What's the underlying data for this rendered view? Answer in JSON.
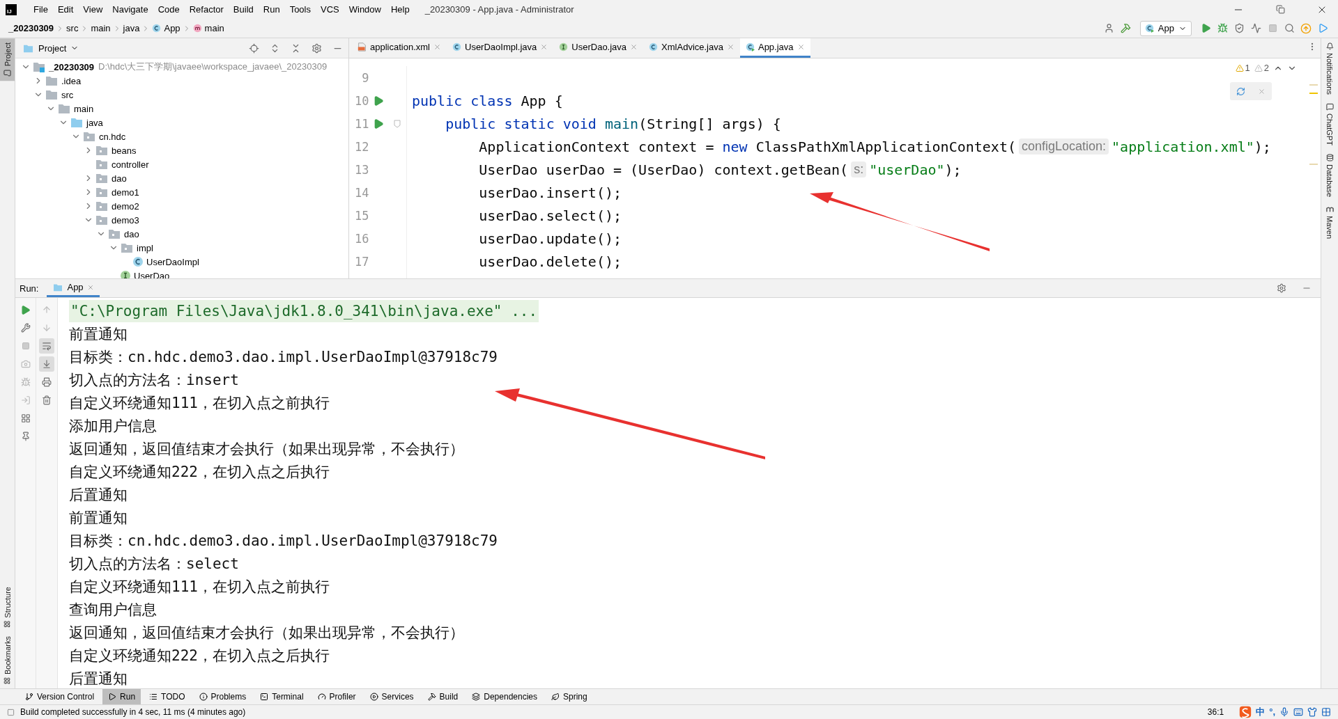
{
  "window": {
    "logo": "IJ",
    "title": "_20230309 - App.java - Administrator"
  },
  "menu": [
    "File",
    "Edit",
    "View",
    "Navigate",
    "Code",
    "Refactor",
    "Build",
    "Run",
    "Tools",
    "VCS",
    "Window",
    "Help"
  ],
  "breadcrumbs": [
    {
      "label": "_20230309",
      "kind": "module"
    },
    {
      "label": "src",
      "kind": "plain"
    },
    {
      "label": "main",
      "kind": "plain"
    },
    {
      "label": "java",
      "kind": "plain"
    },
    {
      "label": "App",
      "kind": "class"
    },
    {
      "label": "main",
      "kind": "method"
    }
  ],
  "run_config": "App",
  "left_tabs": [
    {
      "label": "Project",
      "selected": true
    }
  ],
  "left_bottom_tabs": [
    {
      "label": "Structure",
      "selected": false
    },
    {
      "label": "Bookmarks",
      "selected": false
    }
  ],
  "right_tabs": [
    {
      "label": "Notifications",
      "kind": "bell"
    },
    {
      "label": "ChatGPT",
      "kind": "chat"
    },
    {
      "label": "Database",
      "kind": "database"
    },
    {
      "label": "Maven",
      "kind": "maven"
    }
  ],
  "project": {
    "title": "Project",
    "tree": [
      {
        "label": "_20230309",
        "kind": "module",
        "path": "D:\\hdc\\大三下学期\\javaee\\workspace_javaee\\_20230309",
        "expanded": true,
        "children": [
          {
            "label": ".idea",
            "kind": "folder",
            "expanded": false
          },
          {
            "label": "src",
            "kind": "folder",
            "expanded": true,
            "children": [
              {
                "label": "main",
                "kind": "folder",
                "expanded": true,
                "children": [
                  {
                    "label": "java",
                    "kind": "source",
                    "expanded": true,
                    "children": [
                      {
                        "label": "cn.hdc",
                        "kind": "package",
                        "expanded": true,
                        "children": [
                          {
                            "label": "beans",
                            "kind": "package",
                            "expanded": false
                          },
                          {
                            "label": "controller",
                            "kind": "package"
                          },
                          {
                            "label": "dao",
                            "kind": "package",
                            "expanded": false
                          },
                          {
                            "label": "demo1",
                            "kind": "package",
                            "expanded": false
                          },
                          {
                            "label": "demo2",
                            "kind": "package",
                            "expanded": false
                          },
                          {
                            "label": "demo3",
                            "kind": "package",
                            "expanded": true,
                            "children": [
                              {
                                "label": "dao",
                                "kind": "package",
                                "expanded": true,
                                "children": [
                                  {
                                    "label": "impl",
                                    "kind": "package",
                                    "expanded": true,
                                    "children": [
                                      {
                                        "label": "UserDaoImpl",
                                        "kind": "class"
                                      }
                                    ]
                                  },
                                  {
                                    "label": "UserDao",
                                    "kind": "interface"
                                  }
                                ]
                              }
                            ]
                          }
                        ]
                      }
                    ]
                  }
                ]
              }
            ]
          }
        ]
      }
    ]
  },
  "editor": {
    "tabs": [
      {
        "label": "application.xml",
        "kind": "xml",
        "selected": false
      },
      {
        "label": "UserDaoImpl.java",
        "kind": "class",
        "selected": false
      },
      {
        "label": "UserDao.java",
        "kind": "interface",
        "selected": false
      },
      {
        "label": "XmlAdvice.java",
        "kind": "class",
        "selected": false
      },
      {
        "label": "App.java",
        "kind": "runnable",
        "selected": true
      }
    ],
    "warnings": "1",
    "weak_warnings": "2",
    "lines": [
      {
        "number": "9",
        "run_marker": false,
        "fold_marker": false
      },
      {
        "number": "10",
        "run_marker": true,
        "fold_marker": false,
        "tokens": [
          {
            "kind": "keyword",
            "text": "public class"
          },
          {
            "kind": "plain",
            "text": " App {"
          }
        ]
      },
      {
        "number": "11",
        "run_marker": true,
        "fold_marker": true,
        "tokens": [
          {
            "kind": "keyword",
            "text": "    public static void"
          },
          {
            "kind": "method",
            "text": " main"
          },
          {
            "kind": "plain",
            "text": "(String[] args) {"
          }
        ]
      },
      {
        "number": "12",
        "run_marker": false,
        "fold_marker": false,
        "tokens": [
          {
            "kind": "plain",
            "text": "        ApplicationContext context = "
          },
          {
            "kind": "keyword",
            "text": "new"
          },
          {
            "kind": "plain",
            "text": " ClassPathXmlApplicationContext("
          },
          {
            "kind": "hint",
            "text": "configLocation:"
          },
          {
            "kind": "string",
            "text": "\"application.xml\""
          },
          {
            "kind": "plain",
            "text": ");"
          }
        ]
      },
      {
        "number": "13",
        "run_marker": false,
        "fold_marker": false,
        "tokens": [
          {
            "kind": "plain",
            "text": "        UserDao userDao = (UserDao) context.getBean("
          },
          {
            "kind": "hint",
            "text": "s:"
          },
          {
            "kind": "string",
            "text": "\"userDao\""
          },
          {
            "kind": "plain",
            "text": ");"
          }
        ]
      },
      {
        "number": "14",
        "run_marker": false,
        "fold_marker": false,
        "tokens": [
          {
            "kind": "plain",
            "text": "        userDao.insert();"
          }
        ]
      },
      {
        "number": "15",
        "run_marker": false,
        "fold_marker": false,
        "tokens": [
          {
            "kind": "plain",
            "text": "        userDao.select();"
          }
        ]
      },
      {
        "number": "16",
        "run_marker": false,
        "fold_marker": false,
        "tokens": [
          {
            "kind": "plain",
            "text": "        userDao.update();"
          }
        ]
      },
      {
        "number": "17",
        "run_marker": false,
        "fold_marker": false,
        "tokens": [
          {
            "kind": "plain",
            "text": "        userDao.delete();"
          }
        ]
      }
    ]
  },
  "run": {
    "title": "Run:",
    "tabs": [
      {
        "label": "App",
        "selected": true
      }
    ],
    "console": [
      {
        "kind": "command",
        "text": "\"C:\\Program Files\\Java\\jdk1.8.0_341\\bin\\java.exe\" ..."
      },
      {
        "kind": "output",
        "text": "前置通知"
      },
      {
        "kind": "output",
        "text": "目标类：cn.hdc.demo3.dao.impl.UserDaoImpl@37918c79"
      },
      {
        "kind": "output",
        "text": "切入点的方法名：insert"
      },
      {
        "kind": "output",
        "text": "自定义环绕通知111，在切入点之前执行"
      },
      {
        "kind": "output",
        "text": "添加用户信息"
      },
      {
        "kind": "output",
        "text": "返回通知，返回值结束才会执行（如果出现异常，不会执行）"
      },
      {
        "kind": "output",
        "text": "自定义环绕通知222，在切入点之后执行"
      },
      {
        "kind": "output",
        "text": "后置通知"
      },
      {
        "kind": "output",
        "text": "前置通知"
      },
      {
        "kind": "output",
        "text": "目标类：cn.hdc.demo3.dao.impl.UserDaoImpl@37918c79"
      },
      {
        "kind": "output",
        "text": "切入点的方法名：select"
      },
      {
        "kind": "output",
        "text": "自定义环绕通知111，在切入点之前执行"
      },
      {
        "kind": "output",
        "text": "查询用户信息"
      },
      {
        "kind": "output",
        "text": "返回通知，返回值结束才会执行（如果出现异常，不会执行）"
      },
      {
        "kind": "output",
        "text": "自定义环绕通知222，在切入点之后执行"
      },
      {
        "kind": "output",
        "text": "后置通知"
      }
    ]
  },
  "tool_windows": [
    {
      "label": "Version Control",
      "kind": "vcs",
      "selected": false
    },
    {
      "label": "Run",
      "kind": "run",
      "selected": true
    },
    {
      "label": "TODO",
      "kind": "todo",
      "selected": false
    },
    {
      "label": "Problems",
      "kind": "problems",
      "selected": false
    },
    {
      "label": "Terminal",
      "kind": "terminal",
      "selected": false
    },
    {
      "label": "Profiler",
      "kind": "profiler",
      "selected": false
    },
    {
      "label": "Services",
      "kind": "services",
      "selected": false
    },
    {
      "label": "Build",
      "kind": "build",
      "selected": false
    },
    {
      "label": "Dependencies",
      "kind": "dependencies",
      "selected": false
    },
    {
      "label": "Spring",
      "kind": "spring",
      "selected": false
    }
  ],
  "status": {
    "message": "Build completed successfully in 4 sec, 11 ms (4 minutes ago)",
    "position": "36:1",
    "ime_mode": "中",
    "ime_punct": "°,"
  }
}
